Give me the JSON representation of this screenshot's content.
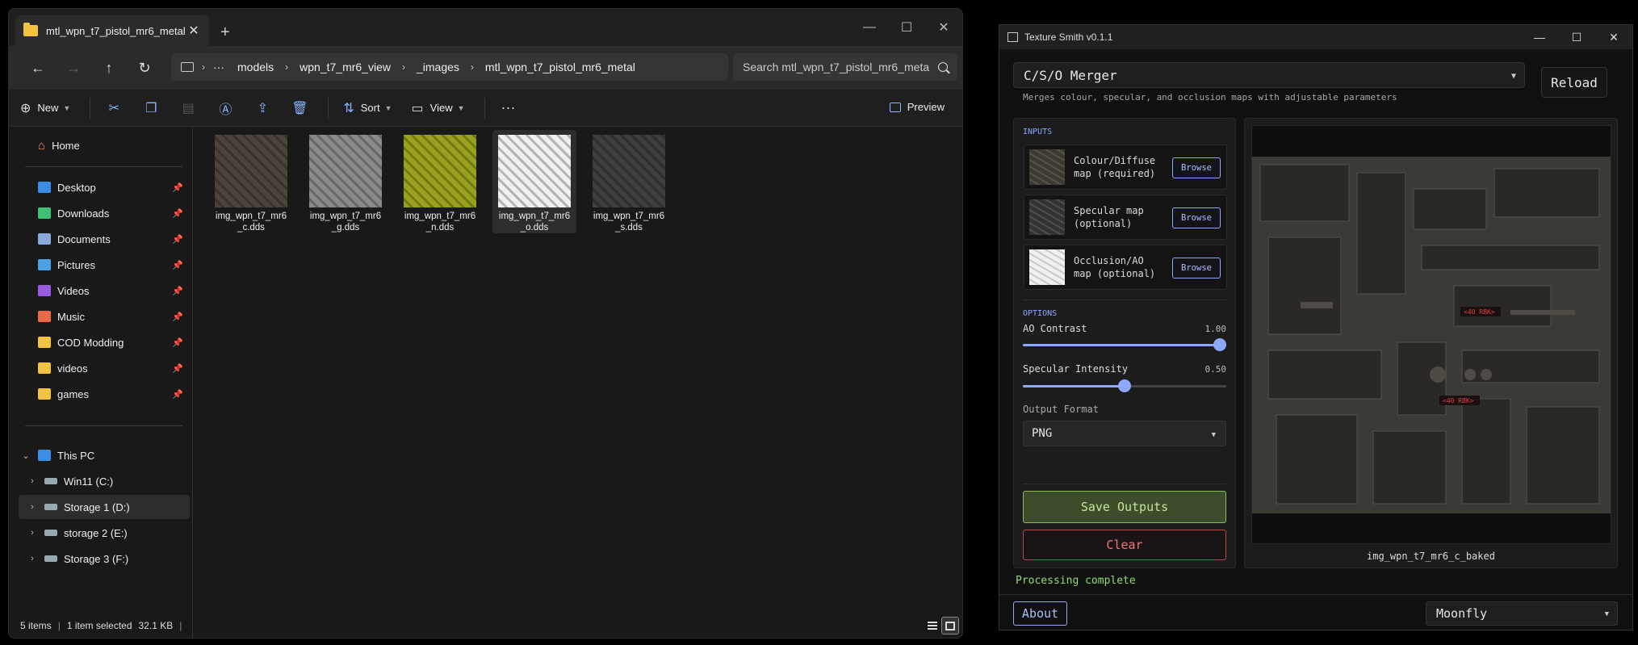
{
  "explorer": {
    "tab_title": "mtl_wpn_t7_pistol_mr6_metal",
    "window_controls": {
      "minimize": "—",
      "maximize": "☐",
      "close": "✕"
    },
    "breadcrumbs": [
      "models",
      "wpn_t7_mr6_view",
      "_images",
      "mtl_wpn_t7_pistol_mr6_metal"
    ],
    "search_placeholder": "Search mtl_wpn_t7_pistol_mr6_meta",
    "toolbar": {
      "new": "New",
      "sort": "Sort",
      "view": "View",
      "preview": "Preview"
    },
    "sidebar": {
      "home": "Home",
      "quick_access": [
        {
          "label": "Desktop",
          "icon": "desktop-icon",
          "color": "#3a8ee6"
        },
        {
          "label": "Downloads",
          "icon": "download-icon",
          "color": "#40c070"
        },
        {
          "label": "Documents",
          "icon": "document-icon",
          "color": "#8aa8d8"
        },
        {
          "label": "Pictures",
          "icon": "pictures-icon",
          "color": "#4aa3e8"
        },
        {
          "label": "Videos",
          "icon": "videos-icon",
          "color": "#9b5ce0"
        },
        {
          "label": "Music",
          "icon": "music-icon",
          "color": "#e86a4a"
        },
        {
          "label": "COD Modding",
          "icon": "folder-icon",
          "color": "#f3c33f"
        },
        {
          "label": "videos",
          "icon": "folder-icon",
          "color": "#f3c33f"
        },
        {
          "label": "games",
          "icon": "folder-icon",
          "color": "#f3c33f"
        }
      ],
      "this_pc": "This PC",
      "drives": [
        {
          "label": "Win11 (C:)",
          "selected": false
        },
        {
          "label": "Storage 1 (D:)",
          "selected": true
        },
        {
          "label": "storage 2 (E:)",
          "selected": false
        },
        {
          "label": "Storage 3 (F:)",
          "selected": false
        }
      ]
    },
    "files": [
      {
        "name": "img_wpn_t7_mr6_c.dds",
        "line1": "img_wpn_t7_mr6",
        "line2": "_c.dds",
        "tint": "#4a443a",
        "selected": false
      },
      {
        "name": "img_wpn_t7_mr6_g.dds",
        "line1": "img_wpn_t7_mr6",
        "line2": "_g.dds",
        "tint": "#8a8a8a",
        "selected": false
      },
      {
        "name": "img_wpn_t7_mr6_n.dds",
        "line1": "img_wpn_t7_mr6",
        "line2": "_n.dds",
        "tint": "#9aa11e",
        "selected": false
      },
      {
        "name": "img_wpn_t7_mr6_o.dds",
        "line1": "img_wpn_t7_mr6",
        "line2": "_o.dds",
        "tint": "#f0f0f0",
        "selected": true
      },
      {
        "name": "img_wpn_t7_mr6_s.dds",
        "line1": "img_wpn_t7_mr6",
        "line2": "_s.dds",
        "tint": "#3e3e3e",
        "selected": false
      }
    ],
    "status": {
      "count": "5 items",
      "selected": "1 item selected",
      "size": "32.1 KB"
    }
  },
  "texture_smith": {
    "title": "Texture Smith v0.1.1",
    "merger": "C/S/O Merger",
    "merger_desc": "Merges colour, specular, and occlusion maps with adjustable parameters",
    "reload": "Reload",
    "inputs_label": "INPUTS",
    "inputs": [
      {
        "line1": "Colour/Diffuse",
        "line2": "map (required)",
        "browse": "Browse",
        "tint": "#3e3a32"
      },
      {
        "line1": "Specular map",
        "line2": "(optional)",
        "browse": "Browse",
        "tint": "#333333"
      },
      {
        "line1": "Occlusion/AO",
        "line2": "map (optional)",
        "browse": "Browse",
        "tint": "#efefef"
      }
    ],
    "options_label": "OPTIONS",
    "ao_contrast": {
      "label": "AO Contrast",
      "value": "1.00",
      "fraction": 0.97
    },
    "specular_intensity": {
      "label": "Specular Intensity",
      "value": "0.50",
      "fraction": 0.5
    },
    "output_format_label": "Output Format",
    "output_format": "PNG",
    "save": "Save Outputs",
    "clear": "Clear",
    "preview_caption": "img_wpn_t7_mr6_c_baked",
    "status": "Processing complete",
    "about": "About",
    "theme": "Moonfly",
    "colors": {
      "accent": "#8fa8ff",
      "save": "#8cb85f",
      "clear": "#e06060",
      "status": "#8fdc74"
    }
  }
}
